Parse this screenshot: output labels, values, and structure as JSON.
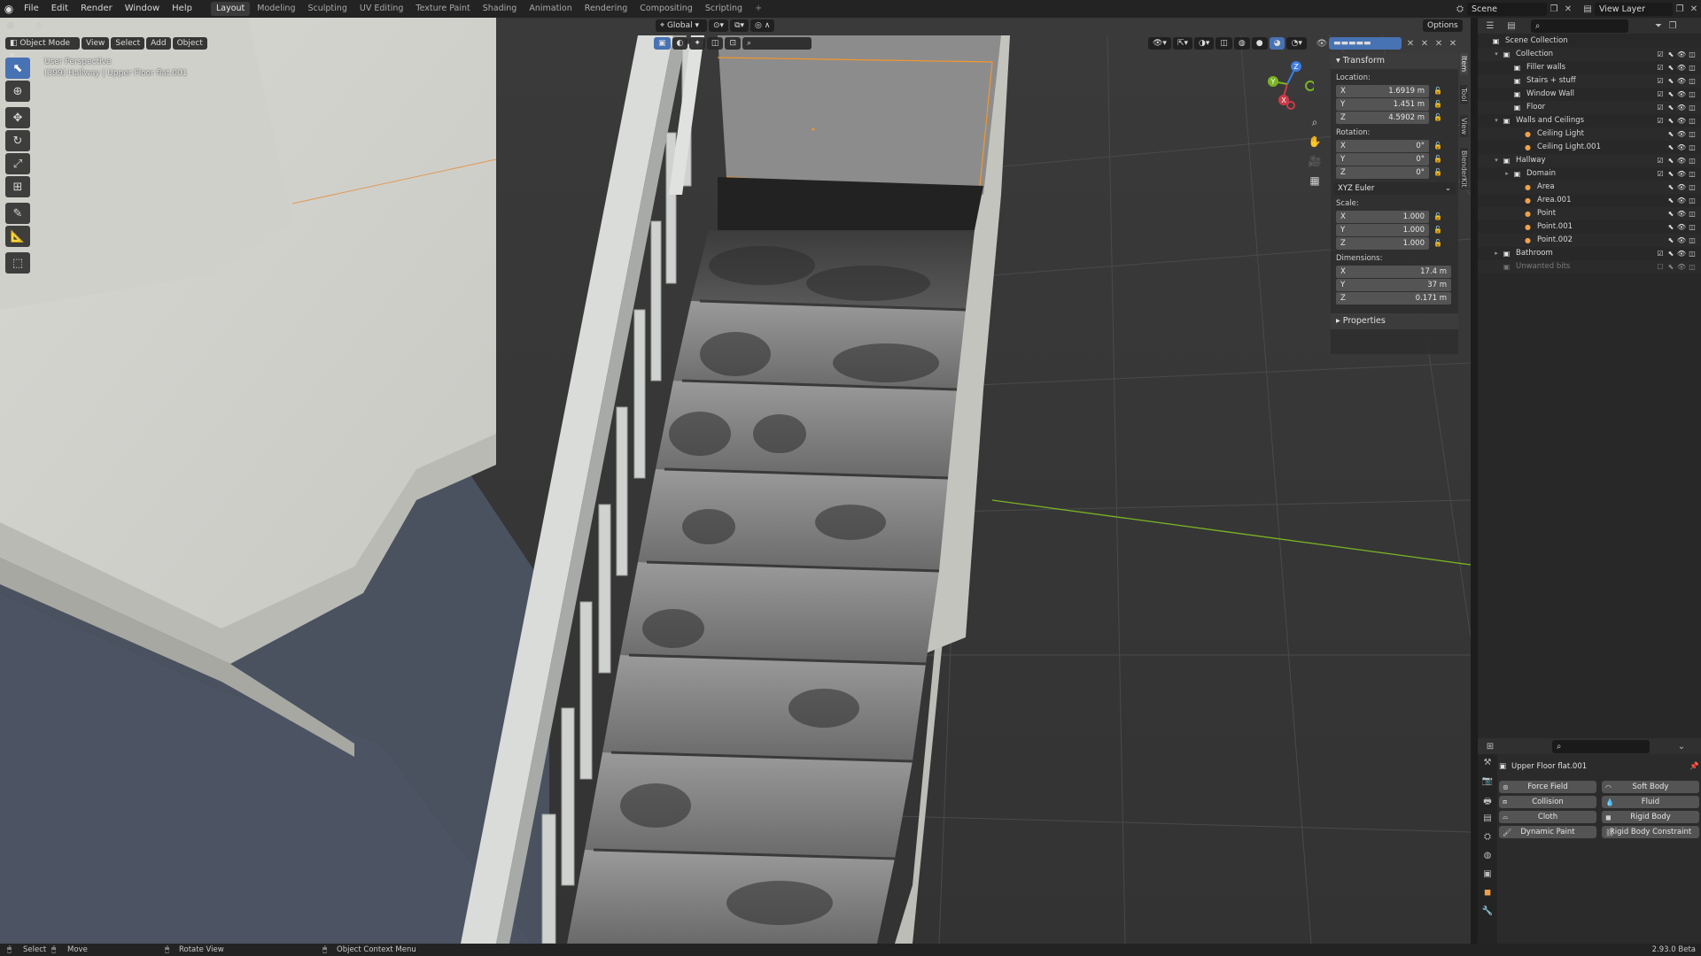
{
  "menu": {
    "items": [
      "File",
      "Edit",
      "Render",
      "Window",
      "Help"
    ]
  },
  "workspaces": {
    "tabs": [
      "Layout",
      "Modeling",
      "Sculpting",
      "UV Editing",
      "Texture Paint",
      "Shading",
      "Animation",
      "Rendering",
      "Compositing",
      "Scripting"
    ],
    "active": "Layout",
    "add": "+"
  },
  "scene": {
    "name": "Scene",
    "view_layer": "View Layer"
  },
  "viewport": {
    "mode": "Object Mode",
    "menus": [
      "View",
      "Select",
      "Add",
      "Object"
    ],
    "orientation": "Global",
    "options": "Options",
    "perspective_label": "User Perspective",
    "context_label": "(399) Hallway | Upper Floor flat.001"
  },
  "gizmo": {
    "z": "Z",
    "y": "Y",
    "x": "X"
  },
  "npanel": {
    "transform_title": "Transform",
    "location_label": "Location:",
    "location": [
      {
        "axis": "X",
        "value": "1.6919 m"
      },
      {
        "axis": "Y",
        "value": "1.451 m"
      },
      {
        "axis": "Z",
        "value": "4.5902 m"
      }
    ],
    "rotation_label": "Rotation:",
    "rotation": [
      {
        "axis": "X",
        "value": "0°"
      },
      {
        "axis": "Y",
        "value": "0°"
      },
      {
        "axis": "Z",
        "value": "0°"
      }
    ],
    "rotation_mode": "XYZ Euler",
    "scale_label": "Scale:",
    "scale": [
      {
        "axis": "X",
        "value": "1.000"
      },
      {
        "axis": "Y",
        "value": "1.000"
      },
      {
        "axis": "Z",
        "value": "1.000"
      }
    ],
    "dimensions_label": "Dimensions:",
    "dimensions": [
      {
        "axis": "X",
        "value": "17.4 m"
      },
      {
        "axis": "Y",
        "value": "37 m"
      },
      {
        "axis": "Z",
        "value": "0.171 m"
      }
    ],
    "properties_title": "Properties",
    "tabs": [
      "Item",
      "Tool",
      "View",
      "BlenderKit"
    ]
  },
  "outliner": {
    "rows": [
      {
        "label": "Scene Collection",
        "depth": 0,
        "icon": "scene-collection-icon",
        "twisty": ""
      },
      {
        "label": "Collection",
        "depth": 1,
        "icon": "collection-icon",
        "twisty": "▾"
      },
      {
        "label": "Filler walls",
        "depth": 2,
        "icon": "collection-icon",
        "twisty": ""
      },
      {
        "label": "Stairs + stuff",
        "depth": 2,
        "icon": "collection-icon",
        "twisty": ""
      },
      {
        "label": "Window Wall",
        "depth": 2,
        "icon": "collection-icon",
        "twisty": ""
      },
      {
        "label": "Floor",
        "depth": 2,
        "icon": "collection-icon",
        "twisty": ""
      },
      {
        "label": "Walls and Ceilings",
        "depth": 2,
        "icon": "collection-icon",
        "twisty": "▾"
      },
      {
        "label": "Ceiling Light",
        "depth": 3,
        "icon": "light-icon",
        "twisty": ""
      },
      {
        "label": "Ceiling Light.001",
        "depth": 3,
        "icon": "light-icon",
        "twisty": ""
      },
      {
        "label": "Hallway",
        "depth": 2,
        "icon": "collection-icon",
        "twisty": "▾"
      },
      {
        "label": "Domain",
        "depth": 3,
        "icon": "collection-icon",
        "twisty": "▸"
      },
      {
        "label": "Area",
        "depth": 3,
        "icon": "light-icon",
        "twisty": ""
      },
      {
        "label": "Area.001",
        "depth": 3,
        "icon": "light-icon",
        "twisty": ""
      },
      {
        "label": "Point",
        "depth": 3,
        "icon": "light-icon",
        "twisty": ""
      },
      {
        "label": "Point.001",
        "depth": 3,
        "icon": "light-icon",
        "twisty": ""
      },
      {
        "label": "Point.002",
        "depth": 3,
        "icon": "light-icon",
        "twisty": ""
      },
      {
        "label": "Bathroom",
        "depth": 2,
        "icon": "collection-icon",
        "twisty": "▸"
      },
      {
        "label": "Unwanted bits",
        "depth": 2,
        "icon": "collection-icon",
        "twisty": ""
      }
    ]
  },
  "properties": {
    "object_name": "Upper Floor flat.001",
    "buttons": [
      "Force Field",
      "Soft Body",
      "Collision",
      "Fluid",
      "Cloth",
      "Rigid Body",
      "Dynamic Paint",
      "Rigid Body Constraint"
    ]
  },
  "status": {
    "select": "Select",
    "move": "Move",
    "rotate": "Rotate View",
    "context": "Object Context Menu",
    "version": "2.93.0 Beta"
  },
  "colors": {
    "accent": "#4772b3",
    "selection": "#f5962a",
    "x_axis": "#cc3a47",
    "y_axis": "#7bb524",
    "z_axis": "#3d7ce0"
  }
}
